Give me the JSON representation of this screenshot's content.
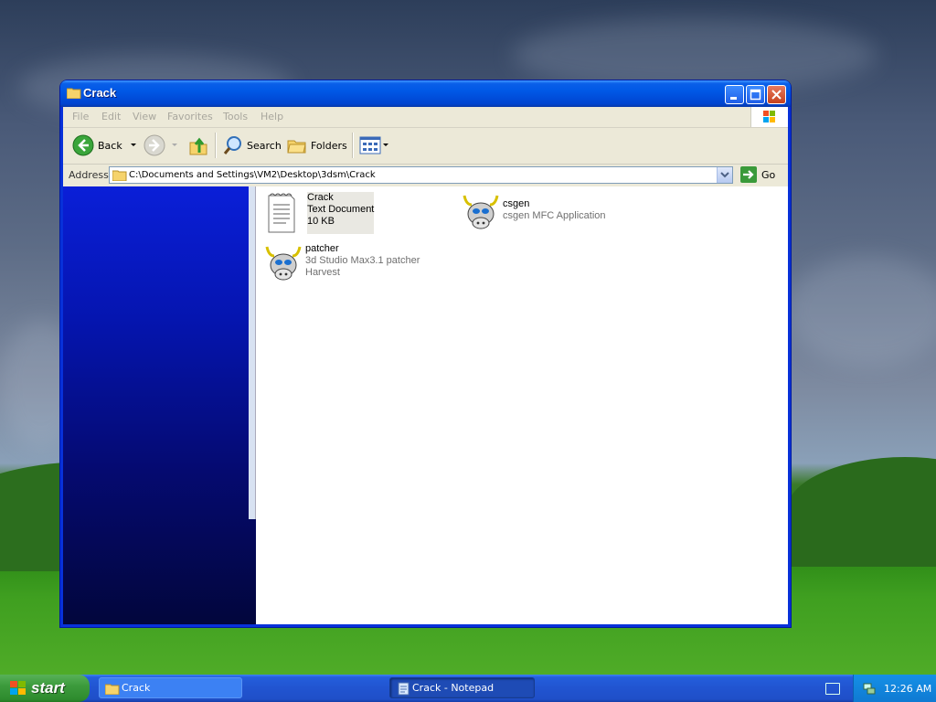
{
  "window": {
    "title": "Crack",
    "menu": [
      "File",
      "Edit",
      "View",
      "Favorites",
      "Tools",
      "Help"
    ],
    "toolbar": {
      "back_label": "Back",
      "search_label": "Search",
      "folders_label": "Folders"
    },
    "address": {
      "label": "Address",
      "value": "C:\\Documents and Settings\\VM2\\Desktop\\3dsm\\Crack",
      "go_label": "Go"
    },
    "files": [
      {
        "name": "Crack",
        "line1": "Text Document",
        "line2": "10 KB",
        "icon": "text-document-icon"
      },
      {
        "name": "csgen",
        "line1": "csgen MFC Application",
        "line2": "",
        "icon": "cow-app-icon"
      },
      {
        "name": "patcher",
        "line1": "3d Studio Max3.1 patcher",
        "line2": "Harvest",
        "icon": "cow-app-icon"
      }
    ]
  },
  "taskbar": {
    "start_label": "start",
    "tasks": [
      "Crack",
      "Crack - Notepad"
    ],
    "clock": "12:26 AM"
  },
  "colors": {
    "titlebar": "#0058e6",
    "taskbar": "#245edb",
    "start_green": "#3c9b3c",
    "left_pane_top": "#0a1fd8"
  }
}
